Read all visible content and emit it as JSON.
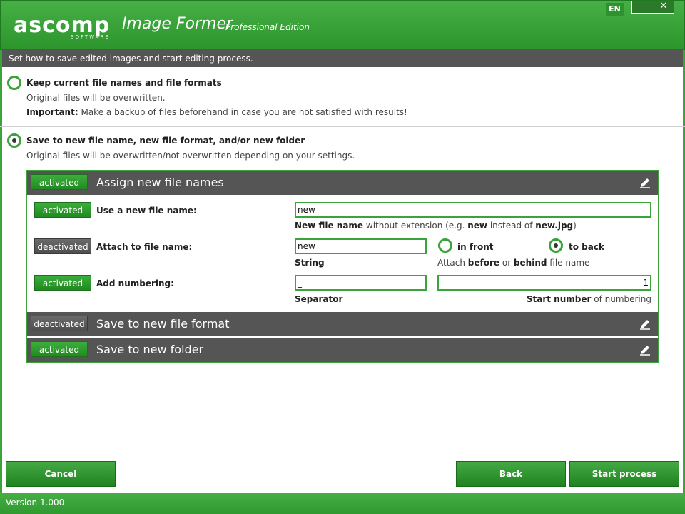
{
  "app": {
    "logo_text": "ascomp",
    "logo_sub": "SOFTWARE",
    "title": "Image Former",
    "edition": "Professional Edition",
    "lang": "EN",
    "minimize": "–",
    "close": "✕"
  },
  "subtitle": "Set how to save edited images and start editing process.",
  "option1": {
    "title": "Keep current file names and file formats",
    "line1": "Original files will be overwritten.",
    "important_label": "Important:",
    "important_text": "Make a backup of files beforehand in case you are not satisfied with results!",
    "checked": false
  },
  "option2": {
    "title": "Save to new file name, new file format, and/or new folder",
    "line1": "Original files will be overwritten/not overwritten depending on your settings.",
    "checked": true
  },
  "sections": {
    "names": {
      "badge": "activated",
      "title": "Assign new file names"
    },
    "format": {
      "badge": "deactivated",
      "title": "Save to new file format"
    },
    "folder": {
      "badge": "activated",
      "title": "Save to new folder"
    }
  },
  "rows": {
    "new_name": {
      "badge": "activated",
      "label": "Use a new file name:",
      "value": "new",
      "hint_bold1": "New file name",
      "hint_text1": " without extension (e.g. ",
      "hint_bold2": "new",
      "hint_text2": " instead of ",
      "hint_bold3": "new.jpg",
      "hint_text3": ")"
    },
    "attach": {
      "badge": "deactivated",
      "label": "Attach to file name:",
      "value": "new_",
      "string_label": "String",
      "radio_front": "in front",
      "radio_back": "to back",
      "hint_text1": "Attach ",
      "hint_bold1": "before",
      "hint_text2": " or ",
      "hint_bold2": "behind",
      "hint_text3": " file name"
    },
    "numbering": {
      "badge": "activated",
      "label": "Add numbering:",
      "separator_value": "_",
      "separator_label": "Separator",
      "start_value": "1",
      "start_label_bold": "Start number",
      "start_label_text": " of numbering"
    }
  },
  "buttons": {
    "cancel": "Cancel",
    "back": "Back",
    "start": "Start process"
  },
  "status": "Version 1.000",
  "colors": {
    "accent": "#3aa33a",
    "header": "#555555"
  }
}
